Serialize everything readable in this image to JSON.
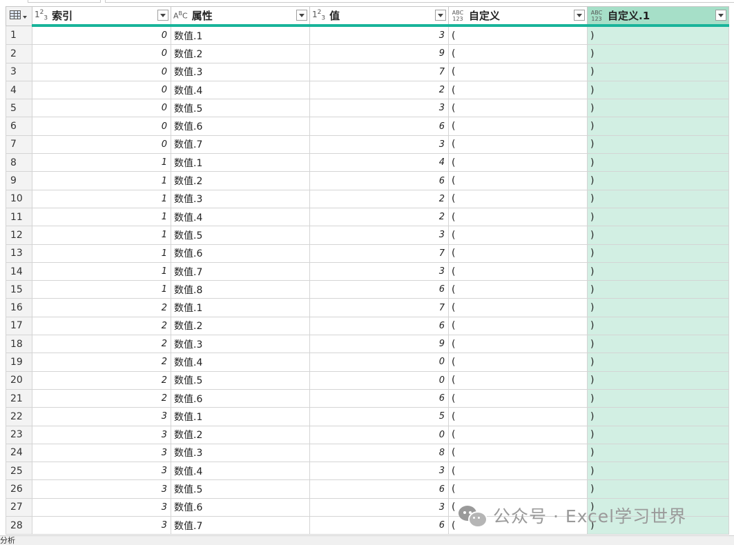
{
  "columns": [
    {
      "label": "索引",
      "type_icon": "whole-number-type-icon"
    },
    {
      "label": "属性",
      "type_icon": "text-type-icon"
    },
    {
      "label": "值",
      "type_icon": "whole-number-type-icon"
    },
    {
      "label": "自定义",
      "type_icon": "any-type-icon"
    },
    {
      "label": "自定义.1",
      "type_icon": "any-type-icon",
      "selected": true
    }
  ],
  "rows": [
    {
      "n": "1",
      "idx": "0",
      "attr": "数值.1",
      "val": "3",
      "c1": "(",
      "c2": ")"
    },
    {
      "n": "2",
      "idx": "0",
      "attr": "数值.2",
      "val": "9",
      "c1": "(",
      "c2": ")"
    },
    {
      "n": "3",
      "idx": "0",
      "attr": "数值.3",
      "val": "7",
      "c1": "(",
      "c2": ")"
    },
    {
      "n": "4",
      "idx": "0",
      "attr": "数值.4",
      "val": "2",
      "c1": "(",
      "c2": ")"
    },
    {
      "n": "5",
      "idx": "0",
      "attr": "数值.5",
      "val": "3",
      "c1": "(",
      "c2": ")"
    },
    {
      "n": "6",
      "idx": "0",
      "attr": "数值.6",
      "val": "6",
      "c1": "(",
      "c2": ")"
    },
    {
      "n": "7",
      "idx": "0",
      "attr": "数值.7",
      "val": "3",
      "c1": "(",
      "c2": ")"
    },
    {
      "n": "8",
      "idx": "1",
      "attr": "数值.1",
      "val": "4",
      "c1": "(",
      "c2": ")"
    },
    {
      "n": "9",
      "idx": "1",
      "attr": "数值.2",
      "val": "6",
      "c1": "(",
      "c2": ")"
    },
    {
      "n": "10",
      "idx": "1",
      "attr": "数值.3",
      "val": "2",
      "c1": "(",
      "c2": ")"
    },
    {
      "n": "11",
      "idx": "1",
      "attr": "数值.4",
      "val": "2",
      "c1": "(",
      "c2": ")"
    },
    {
      "n": "12",
      "idx": "1",
      "attr": "数值.5",
      "val": "3",
      "c1": "(",
      "c2": ")"
    },
    {
      "n": "13",
      "idx": "1",
      "attr": "数值.6",
      "val": "7",
      "c1": "(",
      "c2": ")"
    },
    {
      "n": "14",
      "idx": "1",
      "attr": "数值.7",
      "val": "3",
      "c1": "(",
      "c2": ")"
    },
    {
      "n": "15",
      "idx": "1",
      "attr": "数值.8",
      "val": "6",
      "c1": "(",
      "c2": ")"
    },
    {
      "n": "16",
      "idx": "2",
      "attr": "数值.1",
      "val": "7",
      "c1": "(",
      "c2": ")"
    },
    {
      "n": "17",
      "idx": "2",
      "attr": "数值.2",
      "val": "6",
      "c1": "(",
      "c2": ")"
    },
    {
      "n": "18",
      "idx": "2",
      "attr": "数值.3",
      "val": "9",
      "c1": "(",
      "c2": ")"
    },
    {
      "n": "19",
      "idx": "2",
      "attr": "数值.4",
      "val": "0",
      "c1": "(",
      "c2": ")"
    },
    {
      "n": "20",
      "idx": "2",
      "attr": "数值.5",
      "val": "0",
      "c1": "(",
      "c2": ")"
    },
    {
      "n": "21",
      "idx": "2",
      "attr": "数值.6",
      "val": "6",
      "c1": "(",
      "c2": ")"
    },
    {
      "n": "22",
      "idx": "3",
      "attr": "数值.1",
      "val": "5",
      "c1": "(",
      "c2": ")"
    },
    {
      "n": "23",
      "idx": "3",
      "attr": "数值.2",
      "val": "0",
      "c1": "(",
      "c2": ")"
    },
    {
      "n": "24",
      "idx": "3",
      "attr": "数值.3",
      "val": "8",
      "c1": "(",
      "c2": ")"
    },
    {
      "n": "25",
      "idx": "3",
      "attr": "数值.4",
      "val": "3",
      "c1": "(",
      "c2": ")"
    },
    {
      "n": "26",
      "idx": "3",
      "attr": "数值.5",
      "val": "6",
      "c1": "(",
      "c2": ")"
    },
    {
      "n": "27",
      "idx": "3",
      "attr": "数值.6",
      "val": "3",
      "c1": "(",
      "c2": ")"
    },
    {
      "n": "28",
      "idx": "3",
      "attr": "数值.7",
      "val": "6",
      "c1": "(",
      "c2": ")"
    }
  ],
  "status": {
    "text": "分析"
  },
  "watermark": {
    "text": "公众号 · Excel学习世界",
    "icon": "wechat-icon"
  },
  "colors": {
    "accent": "#19b49a",
    "selected_header": "#a6dfc8",
    "selected_cells": "#d2efe3"
  }
}
